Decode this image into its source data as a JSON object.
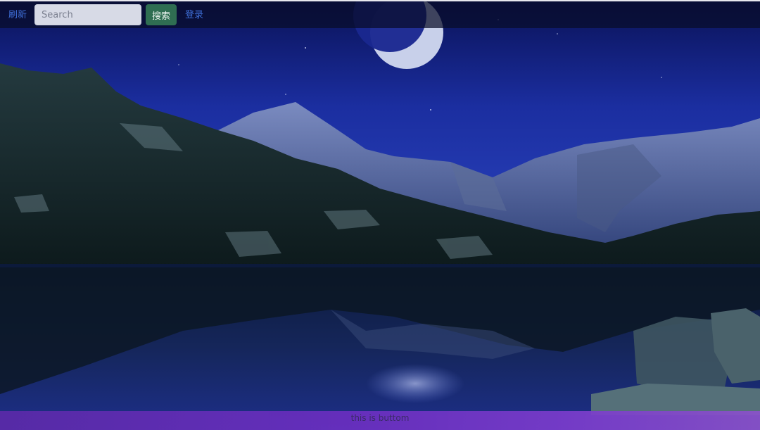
{
  "navbar": {
    "refresh_label": "刷新",
    "search_placeholder": "Search",
    "search_button_label": "搜索",
    "login_label": "登录"
  },
  "footer": {
    "text": "this is buttom"
  },
  "colors": {
    "link": "#3f6fd8",
    "search_button_bg": "#2f6e52",
    "footer_bg": "#6a2fc0",
    "sky": "#1e2f9c"
  },
  "background": {
    "icons": [
      "moon-icon",
      "mountain-range",
      "lake-reflection"
    ]
  }
}
